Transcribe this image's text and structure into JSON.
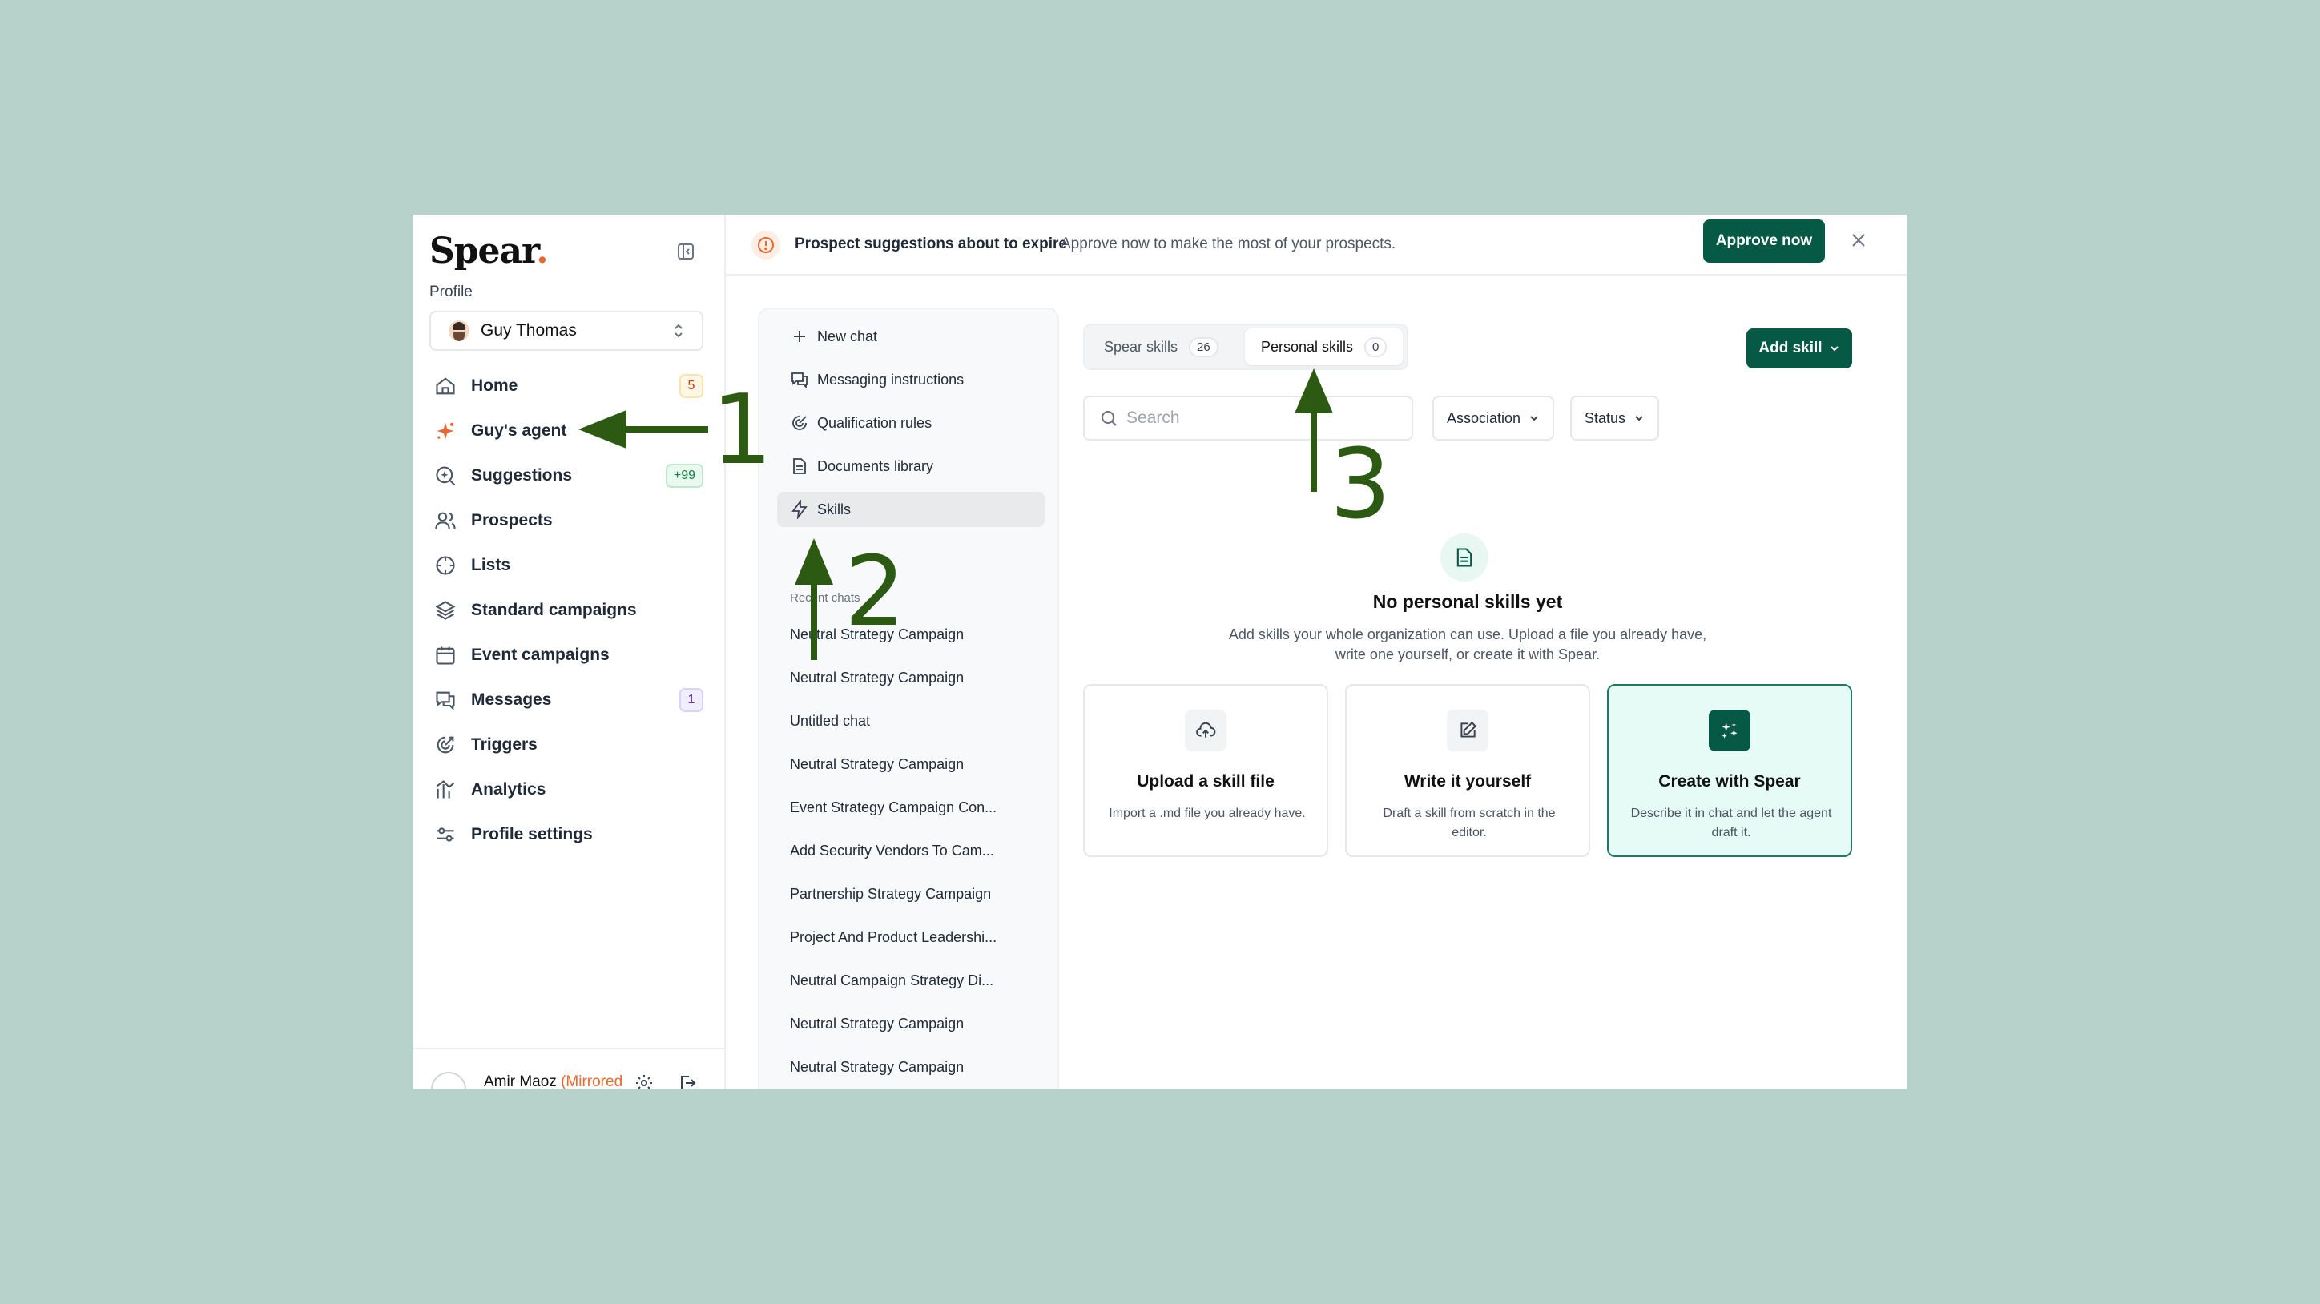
{
  "brand": {
    "logo_text": "Spear",
    "logo_dot": ".",
    "accent": "#065a45",
    "dot_color": "#e8682f"
  },
  "sidebar": {
    "profile_label": "Profile",
    "profile_name": "Guy Thomas",
    "items": [
      {
        "label": "Home",
        "icon": "home-icon",
        "badge": "5"
      },
      {
        "label": "Guy's agent",
        "icon": "sparkle-icon"
      },
      {
        "label": "Suggestions",
        "icon": "search-sparkle-icon",
        "badge": "+99"
      },
      {
        "label": "Prospects",
        "icon": "users-icon"
      },
      {
        "label": "Lists",
        "icon": "crosshair-icon"
      },
      {
        "label": "Standard campaigns",
        "icon": "layers-icon"
      },
      {
        "label": "Event campaigns",
        "icon": "calendar-icon"
      },
      {
        "label": "Messages",
        "icon": "messages-icon",
        "badge": "1"
      },
      {
        "label": "Triggers",
        "icon": "target-icon"
      },
      {
        "label": "Analytics",
        "icon": "chart-icon"
      },
      {
        "label": "Profile settings",
        "icon": "settings-sliders-icon"
      }
    ],
    "bottom_user": "Amir Maoz",
    "bottom_user_tag": "(Mirrored"
  },
  "banner": {
    "title": "Prospect suggestions about to expire",
    "subtitle": "Approve now to make the most of your prospects.",
    "approve_label": "Approve now"
  },
  "chat_panel": {
    "actions": [
      {
        "label": "New chat",
        "icon": "plus-icon"
      },
      {
        "label": "Messaging instructions",
        "icon": "messages-icon"
      },
      {
        "label": "Qualification rules",
        "icon": "target-icon"
      },
      {
        "label": "Documents library",
        "icon": "document-icon"
      },
      {
        "label": "Skills",
        "icon": "lightning-icon",
        "active": true
      }
    ],
    "recent_label": "Recent chats",
    "recent": [
      "Neutral Strategy Campaign",
      "Neutral Strategy Campaign",
      "Untitled chat",
      "Neutral Strategy Campaign",
      "Event Strategy Campaign Con...",
      "Add Security Vendors To Cam...",
      "Partnership Strategy Campaign",
      "Project And Product Leadershi...",
      "Neutral Campaign Strategy Di...",
      "Neutral Strategy Campaign",
      "Neutral Strategy Campaign"
    ]
  },
  "skills": {
    "tabs": [
      {
        "label": "Spear skills",
        "count": "26"
      },
      {
        "label": "Personal skills",
        "count": "0",
        "active": true
      }
    ],
    "add_label": "Add skill",
    "search_placeholder": "Search",
    "filters": [
      "Association",
      "Status"
    ],
    "empty_title": "No personal skills yet",
    "empty_sub": "Add skills your whole organization can use. Upload a file you already have, write one yourself, or create it with Spear.",
    "cards": [
      {
        "title": "Upload a skill file",
        "desc": "Import a .md file you already have.",
        "icon": "upload-cloud-icon"
      },
      {
        "title": "Write it yourself",
        "desc": "Draft a skill from scratch in the editor.",
        "icon": "edit-icon"
      },
      {
        "title": "Create with Spear",
        "desc": "Describe it in chat and let the agent draft it.",
        "icon": "sparkles-icon"
      }
    ]
  },
  "annotations": [
    "1",
    "2",
    "3"
  ]
}
